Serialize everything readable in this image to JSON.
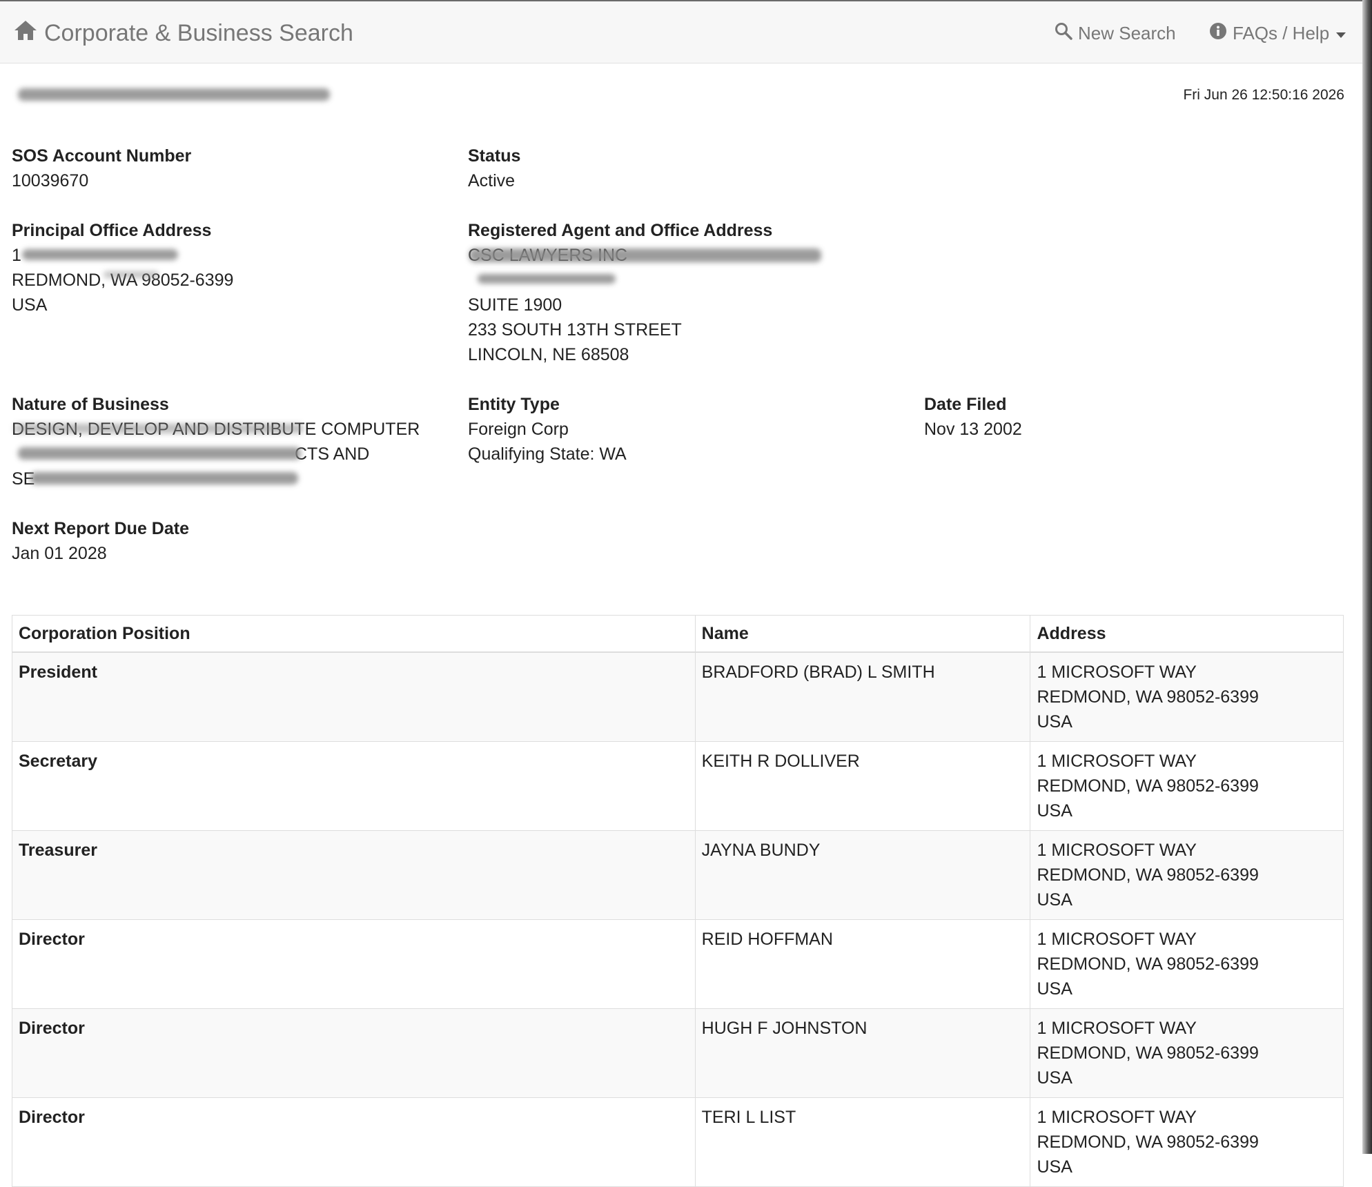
{
  "nav": {
    "brand_label": "Corporate & Business Search",
    "new_search_label": "New Search",
    "help_label": "FAQs / Help",
    "brand_icon": "home-icon",
    "search_icon": "search-icon",
    "help_icon": "info-circle-icon"
  },
  "header": {
    "timestamp": "Fri Jun 26 12:50:16 2026"
  },
  "details": {
    "sos_account_label": "SOS Account Number",
    "sos_account_value": "10039670",
    "status_label": "Status",
    "status_value": "Active",
    "principal_label": "Principal Office Address",
    "principal_line1": "1",
    "principal_line2": "REDMOND, WA 98052-6399",
    "principal_line3": "USA",
    "agent_label": "Registered Agent and Office Address",
    "agent_line1": "CSC LAWYERS INC",
    "agent_line3": "SUITE 1900",
    "agent_line4": "233 SOUTH 13TH STREET",
    "agent_line5": "LINCOLN, NE 68508",
    "nature_label": "Nature of Business",
    "nature_line1": "DESIGN, DEVELOP AND DISTRIBUTE COMPUTER",
    "nature_line2": "CTS AND",
    "nature_line3": "SE",
    "entity_label": "Entity Type",
    "entity_value": "Foreign Corp",
    "entity_qualifying": "Qualifying State: WA",
    "date_filed_label": "Date Filed",
    "date_filed_value": "Nov 13 2002",
    "next_report_label": "Next Report Due Date",
    "next_report_value": "Jan 01 2028"
  },
  "officers": {
    "headers": [
      "Corporation Position",
      "Name",
      "Address"
    ],
    "rows": [
      {
        "position": "President",
        "name": "BRADFORD (BRAD) L SMITH",
        "addr1": "1 MICROSOFT WAY",
        "addr2": "REDMOND, WA 98052-6399",
        "addr3": "USA"
      },
      {
        "position": "Secretary",
        "name": "KEITH R DOLLIVER",
        "addr1": "1 MICROSOFT WAY",
        "addr2": "REDMOND, WA 98052-6399",
        "addr3": "USA"
      },
      {
        "position": "Treasurer",
        "name": "JAYNA BUNDY",
        "addr1": "1 MICROSOFT WAY",
        "addr2": "REDMOND, WA 98052-6399",
        "addr3": "USA"
      },
      {
        "position": "Director",
        "name": "REID HOFFMAN",
        "addr1": "1 MICROSOFT WAY",
        "addr2": "REDMOND, WA 98052-6399",
        "addr3": "USA"
      },
      {
        "position": "Director",
        "name": "HUGH F JOHNSTON",
        "addr1": "1 MICROSOFT WAY",
        "addr2": "REDMOND, WA 98052-6399",
        "addr3": "USA"
      },
      {
        "position": "Director",
        "name": "TERI L LIST",
        "addr1": "1 MICROSOFT WAY",
        "addr2": "REDMOND, WA 98052-6399",
        "addr3": "USA"
      }
    ]
  }
}
